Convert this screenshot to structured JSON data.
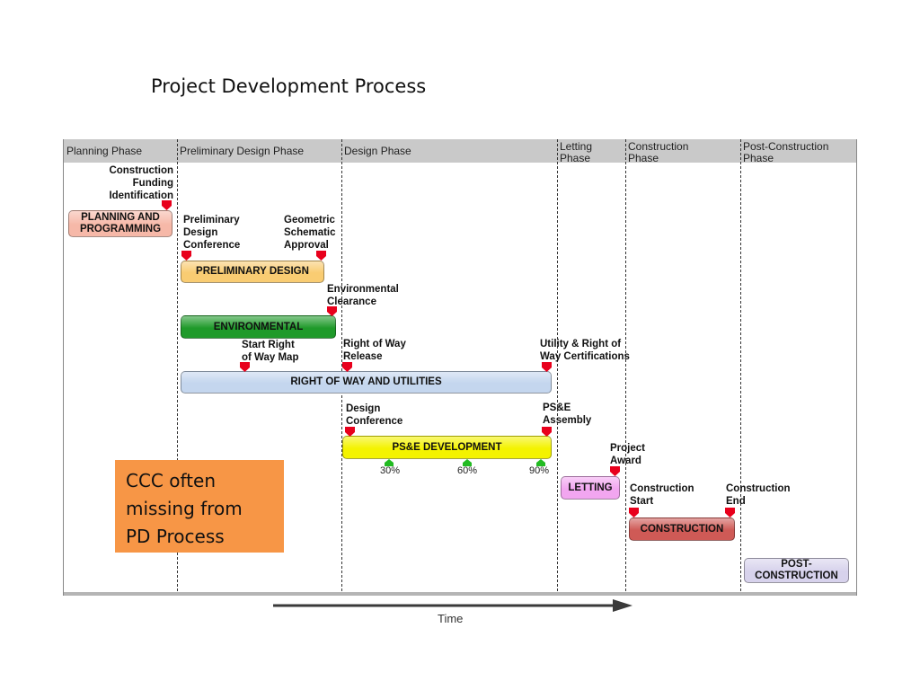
{
  "title": "Project Development Process",
  "phases": [
    {
      "label": "Planning Phase"
    },
    {
      "label": "Preliminary Design Phase"
    },
    {
      "label": "Design Phase"
    },
    {
      "label": "Letting\nPhase"
    },
    {
      "label": "Construction\nPhase"
    },
    {
      "label": "Post-Construction\nPhase"
    }
  ],
  "bars": {
    "planning": "PLANNING AND\nPROGRAMMING",
    "preliminary_design": "PRELIMINARY DESIGN",
    "environmental": "ENVIRONMENTAL",
    "right_of_way": "RIGHT OF WAY AND UTILITIES",
    "pse_development": "PS&E DEVELOPMENT",
    "letting": "LETTING",
    "construction": "CONSTRUCTION",
    "post_construction": "POST-\nCONSTRUCTION"
  },
  "milestones": {
    "construction_funding": "Construction\nFunding\nIdentification",
    "preliminary_design_conference": "Preliminary\nDesign\nConference",
    "geometric_schematic_approval": "Geometric\nSchematic\nApproval",
    "environmental_clearance": "Environmental\nClearance",
    "start_row_map": "Start Right\nof Way Map",
    "row_release": "Right of Way\nRelease",
    "utility_row_certifications": "Utility & Right of\nWay Certifications",
    "design_conference": "Design\nConference",
    "pse_assembly": "PS&E\nAssembly",
    "project_award": "Project\nAward",
    "construction_start": "Construction\nStart",
    "construction_end": "Construction\nEnd"
  },
  "progress_markers": [
    "30%",
    "60%",
    "90%"
  ],
  "note": "CCC often\nmissing from\nPD Process",
  "axis_label": "Time",
  "colors": {
    "milestone_marker": "#e8001c",
    "progress_marker": "#22bb22",
    "note_box": "#f79646",
    "planning": "#f6b8a8",
    "preliminary_design": "#f9cc72",
    "environmental": "#1f9a2a",
    "right_of_way": "#c4d6ee",
    "pse_development": "#f4f300",
    "letting": "#f2a6f0",
    "construction": "#cf5a56",
    "post_construction": "#d7d2ec"
  }
}
